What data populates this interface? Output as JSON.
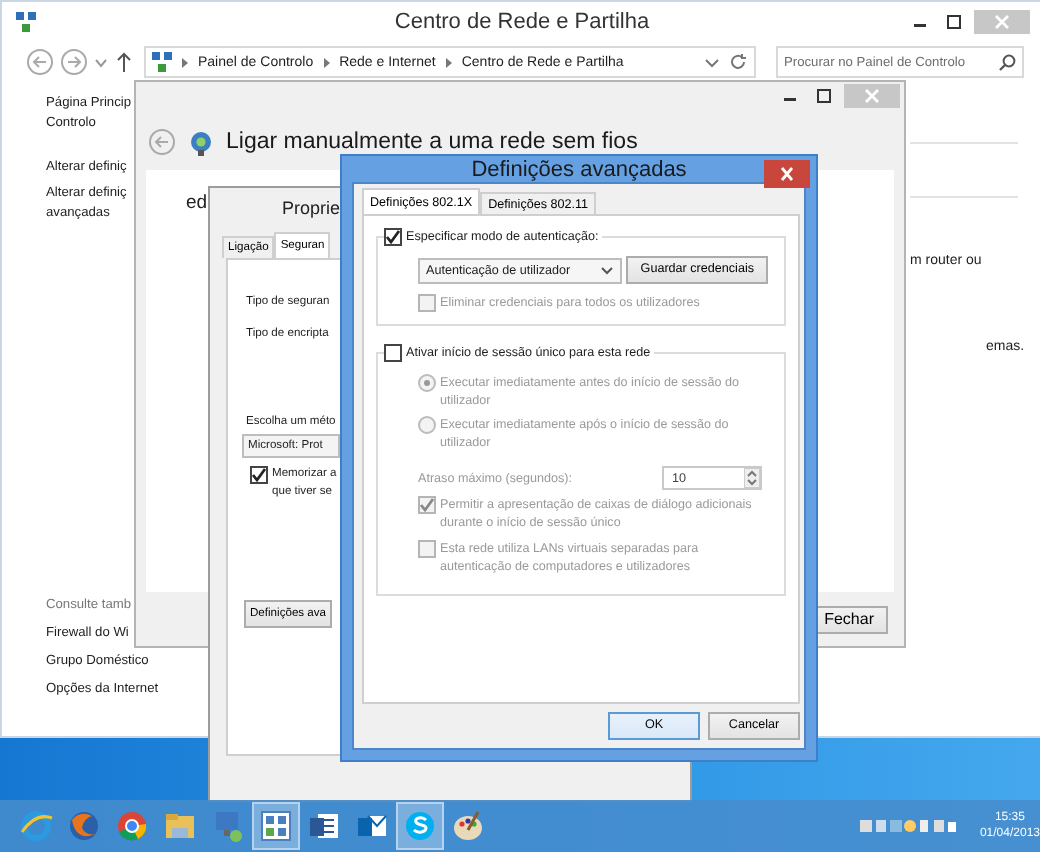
{
  "control_panel": {
    "title": "Centro de Rede e Partilha",
    "breadcrumb": [
      "Painel de Controlo",
      "Rede e Internet",
      "Centro de Rede e Partilha"
    ],
    "search": {
      "placeholder": "Procurar no Painel de Controlo"
    },
    "tasks": [
      {
        "lines": [
          "Página Princip",
          "Controlo"
        ]
      },
      {
        "lines": [
          "Alterar definiç"
        ]
      },
      {
        "lines": [
          "Alterar definiç",
          "avançadas"
        ]
      }
    ],
    "see_also": {
      "heading": "Consulte tamb",
      "links": [
        "Firewall do Wi",
        "Grupo Doméstico",
        "Opções da Internet"
      ]
    },
    "fragments": [
      "m router ou",
      "emas."
    ]
  },
  "wizard": {
    "title": "Ligar manualmente a uma rede sem fios",
    "fragment": "ed",
    "close_button": "Fechar"
  },
  "properties": {
    "title": "Proprie",
    "tabs": [
      {
        "label": "Ligação",
        "selected": false
      },
      {
        "label": "Seguran",
        "selected": true
      }
    ],
    "labels": [
      "Tipo de seguran",
      "Tipo de encripta"
    ],
    "method_label": "Escolha um méto",
    "method": "Microsoft: Prot",
    "remember": {
      "lines": [
        "Memorizar a",
        "que tiver se"
      ],
      "checked": true
    },
    "advanced_button": "Definições ava"
  },
  "dialog": {
    "title": "Definições avançadas",
    "tabs": [
      {
        "label": "Definições 802.1X",
        "selected": true
      },
      {
        "label": "Definições 802.11",
        "selected": false
      }
    ],
    "auth": {
      "label": "Especificar modo de autenticação:",
      "checked": true,
      "mode": "Autenticação de utilizador",
      "save_button": "Guardar credenciais",
      "delete": {
        "label": "Eliminar credenciais para todos os utilizadores",
        "checked": false,
        "disabled": true
      }
    },
    "sso": {
      "label": "Ativar início de sessão único para esta rede",
      "checked": false,
      "radios": [
        {
          "label": "Executar imediatamente antes do início de sessão do utilizador",
          "selected": true,
          "disabled": true
        },
        {
          "label": "Executar imediatamente após o início de sessão do utilizador",
          "selected": false,
          "disabled": true
        }
      ],
      "delay": {
        "label": "Atraso máximo (segundos):",
        "value": "10",
        "disabled": true
      },
      "options": [
        {
          "label": "Permitir a apresentação de caixas de diálogo adicionais durante o início de sessão único",
          "checked": true,
          "disabled": true
        },
        {
          "label": "Esta rede utiliza LANs virtuais separadas para autenticação de computadores e utilizadores",
          "checked": false,
          "disabled": true
        }
      ]
    },
    "buttons": [
      "OK",
      "Cancelar"
    ]
  },
  "taskbar": {
    "items": [
      {
        "kind": "ie",
        "selected": false
      },
      {
        "kind": "firefox",
        "selected": false
      },
      {
        "kind": "chrome",
        "selected": false
      },
      {
        "kind": "folder",
        "selected": false
      },
      {
        "kind": "network",
        "selected": false
      },
      {
        "kind": "control",
        "selected": true
      },
      {
        "kind": "word",
        "selected": false
      },
      {
        "kind": "outlook",
        "selected": false
      },
      {
        "kind": "skype",
        "selected": true
      },
      {
        "kind": "paint",
        "selected": false
      }
    ],
    "clock": {
      "time": "15:35",
      "date": "01/04/2013"
    }
  }
}
